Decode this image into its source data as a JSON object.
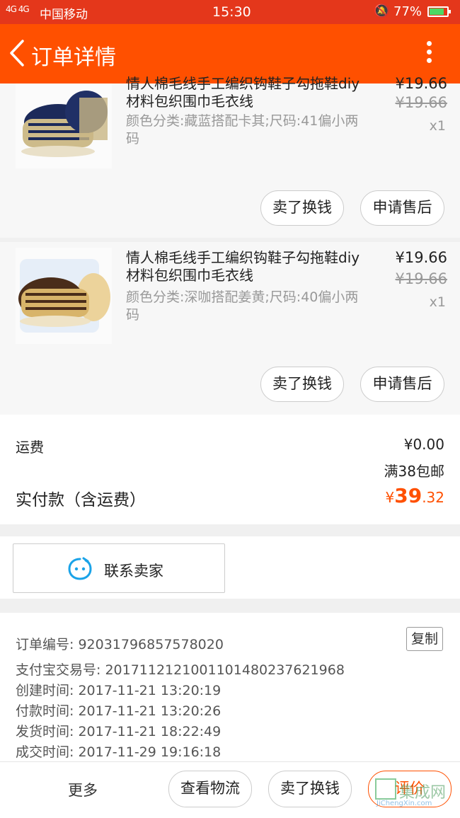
{
  "status_bar": {
    "signal": "4G 4G",
    "carrier": "中国移动",
    "time": "15:30",
    "battery": "77%"
  },
  "header": {
    "title": "订单详情"
  },
  "products": [
    {
      "name": "情人棉毛线手工编织钩鞋子勾拖鞋diy材料包织围巾毛衣线",
      "sku": "颜色分类:藏蓝搭配卡其;尺码:41偏小两码",
      "price": "¥19.66",
      "original_price": "¥19.66",
      "qty": "x1",
      "btn_sell": "卖了换钱",
      "btn_after_sale": "申请售后"
    },
    {
      "name": "情人棉毛线手工编织钩鞋子勾拖鞋diy材料包织围巾毛衣线",
      "sku": "颜色分类:深咖搭配姜黄;尺码:40偏小两码",
      "price": "¥19.66",
      "original_price": "¥19.66",
      "qty": "x1",
      "btn_sell": "卖了换钱",
      "btn_after_sale": "申请售后"
    }
  ],
  "summary": {
    "shipping_label": "运费",
    "shipping_value": "¥0.00",
    "free_shipping_note": "满38包邮",
    "paid_label": "实付款（含运费）",
    "paid_currency": "¥",
    "paid_int": "39",
    "paid_dec": ".32"
  },
  "contact": {
    "label": "联系卖家"
  },
  "order_info": {
    "order_no": "订单编号: 92031796857578020",
    "copy_label": "复制",
    "alipay_no": "支付宝交易号: 2017112121001101480237621968",
    "created": "创建时间: 2017-11-21 13:20:19",
    "paid": "付款时间: 2017-11-21 13:20:26",
    "shipped": "发货时间: 2017-11-21 18:22:49",
    "completed": "成交时间: 2017-11-29 19:16:18"
  },
  "bottom_bar": {
    "more": "更多",
    "logistics": "查看物流",
    "sell": "卖了换钱",
    "rate": "评价"
  },
  "watermark": {
    "text": "集成网",
    "url": "JiChengXin.com"
  },
  "colors": {
    "header_bg": "#ff5000",
    "price_accent": "#ff5000"
  }
}
